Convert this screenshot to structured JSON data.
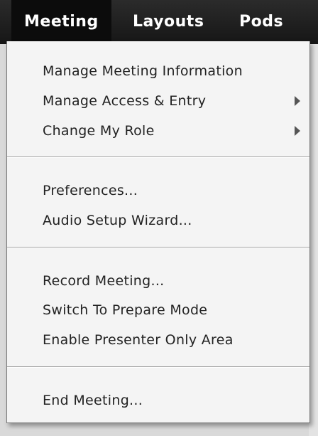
{
  "menubar": {
    "items": [
      {
        "label": "Meeting"
      },
      {
        "label": "Layouts"
      },
      {
        "label": "Pods"
      }
    ]
  },
  "meeting_menu": {
    "groups": [
      {
        "items": [
          {
            "label": "Manage Meeting Information",
            "has_submenu": false
          },
          {
            "label": "Manage Access & Entry",
            "has_submenu": true
          },
          {
            "label": "Change My Role",
            "has_submenu": true
          }
        ]
      },
      {
        "items": [
          {
            "label": "Preferences...",
            "has_submenu": false
          },
          {
            "label": "Audio Setup Wizard...",
            "has_submenu": false
          }
        ]
      },
      {
        "items": [
          {
            "label": "Record Meeting...",
            "has_submenu": false
          },
          {
            "label": "Switch To Prepare Mode",
            "has_submenu": false
          },
          {
            "label": "Enable Presenter Only Area",
            "has_submenu": false
          }
        ]
      },
      {
        "items": [
          {
            "label": "End Meeting...",
            "has_submenu": false
          }
        ]
      }
    ]
  },
  "colors": {
    "menubar_bg": "#1c1c1c",
    "menubar_text": "#ffffff",
    "dropdown_bg": "#f4f4f4",
    "item_text": "#222222",
    "separator": "#a5a5a5"
  }
}
